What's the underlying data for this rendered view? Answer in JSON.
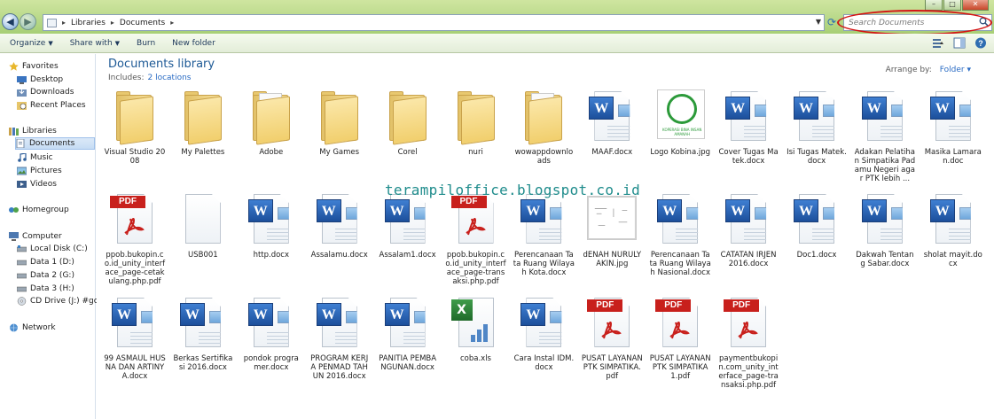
{
  "window": {
    "breadcrumb": [
      "Libraries",
      "Documents"
    ],
    "search_placeholder": "Search Documents"
  },
  "toolbar": {
    "organize": "Organize",
    "share_with": "Share with",
    "burn": "Burn",
    "new_folder": "New folder"
  },
  "navpane": {
    "favorites": "Favorites",
    "desktop": "Desktop",
    "downloads": "Downloads",
    "recent": "Recent Places",
    "libraries": "Libraries",
    "documents": "Documents",
    "music": "Music",
    "pictures": "Pictures",
    "videos": "Videos",
    "homegroup": "Homegroup",
    "computer": "Computer",
    "local_disk": "Local Disk (C:)",
    "data1": "Data 1 (D:)",
    "data2": "Data 2 (G:)",
    "data3": "Data 3 (H:)",
    "cd_drive": "CD Drive (J:) #go4G",
    "network": "Network"
  },
  "library": {
    "title": "Documents library",
    "includes_label": "Includes:",
    "includes_link": "2 locations",
    "arrange_label": "Arrange by:",
    "arrange_value": "Folder",
    "watermark": "terampiloffice.blogspot.co.id"
  },
  "files": [
    {
      "name": "Visual Studio 2008",
      "type": "folder"
    },
    {
      "name": "My Palettes",
      "type": "folder"
    },
    {
      "name": "Adobe",
      "type": "folder-paper"
    },
    {
      "name": "My Games",
      "type": "folder"
    },
    {
      "name": "Corel",
      "type": "folder"
    },
    {
      "name": "nuri",
      "type": "folder"
    },
    {
      "name": "wowappdownloads",
      "type": "folder-paper"
    },
    {
      "name": "MAAF.docx",
      "type": "word"
    },
    {
      "name": "Logo Kobina.jpg",
      "type": "logo"
    },
    {
      "name": "Cover Tugas Matek.docx",
      "type": "word"
    },
    {
      "name": "Isi Tugas Matek.docx",
      "type": "word"
    },
    {
      "name": "Adakan Pelatihan Simpatika Padamu Negeri agar PTK lebih ...",
      "type": "word"
    },
    {
      "name": "Masika Lamaran.doc",
      "type": "word"
    },
    {
      "name": "ppob.bukopin.co.id_unity_interface_page-cetakulang.php.pdf",
      "type": "pdf"
    },
    {
      "name": "USB001",
      "type": "blank"
    },
    {
      "name": "http.docx",
      "type": "word"
    },
    {
      "name": "Assalamu.docx",
      "type": "word"
    },
    {
      "name": "Assalam1.docx",
      "type": "word"
    },
    {
      "name": "ppob.bukopin.co.id_unity_interface_page-transaksi.php.pdf",
      "type": "pdf"
    },
    {
      "name": "Perencanaan Tata Ruang Wilayah Kota.docx",
      "type": "word"
    },
    {
      "name": "dENAH NURULYAKIN.jpg",
      "type": "sketch"
    },
    {
      "name": "Perencanaan Tata Ruang Wilayah Nasional.docx",
      "type": "word"
    },
    {
      "name": "CATATAN IRJEN 2016.docx",
      "type": "word"
    },
    {
      "name": "Doc1.docx",
      "type": "word"
    },
    {
      "name": "Dakwah Tentang Sabar.docx",
      "type": "word"
    },
    {
      "name": "sholat mayit.docx",
      "type": "word"
    },
    {
      "name": "99 ASMAUL HUSNA DAN ARTINYA.docx",
      "type": "word"
    },
    {
      "name": "Berkas Sertifikasi 2016.docx",
      "type": "word"
    },
    {
      "name": "pondok programer.docx",
      "type": "word"
    },
    {
      "name": "PROGRAM KERJA PENMAD TAHUN 2016.docx",
      "type": "word"
    },
    {
      "name": "PANITIA PEMBANGUNAN.docx",
      "type": "word"
    },
    {
      "name": "coba.xls",
      "type": "excel"
    },
    {
      "name": "Cara Instal IDM.docx",
      "type": "word"
    },
    {
      "name": "PUSAT LAYANAN PTK SIMPATIKA.pdf",
      "type": "pdf"
    },
    {
      "name": "PUSAT LAYANAN PTK SIMPATIKA1.pdf",
      "type": "pdf"
    },
    {
      "name": "paymentbukopin.com_unity_interface_page-transaksi.php.pdf",
      "type": "pdf"
    }
  ],
  "icon_glyphs": {
    "word": "W",
    "pdf": "PDF",
    "excel": "X",
    "logo": "KOPERASI BINA INSAN AMANAH"
  },
  "colors": {
    "accent_link": "#2b6cc4",
    "title_blue": "#1e5a96",
    "highlight_oval": "#d41414",
    "watermark": "#1f8c8c"
  }
}
